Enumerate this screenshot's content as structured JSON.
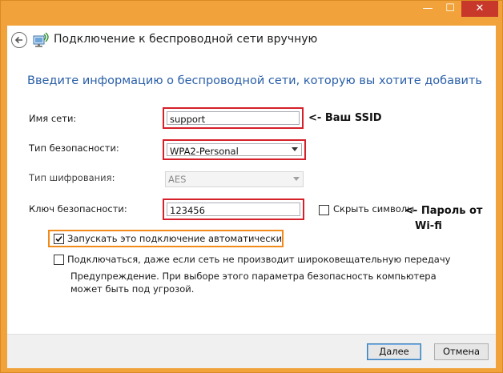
{
  "window": {
    "minimize_glyph": "—",
    "maximize_glyph": "☐",
    "close_glyph": "✕",
    "title": "Подключение к беспроводной сети вручную"
  },
  "main": {
    "instruction": "Введите информацию о беспроводной сети, которую вы хотите добавить",
    "network_name": {
      "label": "Имя сети:",
      "value": "support",
      "annotation": "<- Ваш SSID"
    },
    "security_type": {
      "label": "Тип безопасности:",
      "value": "WPA2-Personal"
    },
    "encryption_type": {
      "label": "Тип шифрования:",
      "value": "AES"
    },
    "security_key": {
      "label": "Ключ безопасности:",
      "value": "123456",
      "hide_chars_label": "Скрыть символы",
      "hide_chars_checked": false,
      "annotation_line1": "<- Пароль от",
      "annotation_line2": "Wi-fi"
    },
    "auto_connect": {
      "label": "Запускать это подключение автоматически",
      "checked": true
    },
    "connect_hidden": {
      "label": "Подключаться, даже если сеть не производит широковещательную передачу",
      "checked": false
    },
    "warning": "Предупреждение. При выборе этого параметра безопасность компьютера может быть под угрозой."
  },
  "footer": {
    "next_label": "Далее",
    "cancel_label": "Отмена"
  },
  "colors": {
    "frame": "#f2a23a",
    "close": "#c7372a",
    "heading": "#2a5fa8",
    "highlight_red": "#d6202a",
    "highlight_orange": "#f08a1a"
  },
  "icons": [
    "back-arrow-icon",
    "wireless-network-icon",
    "checkmark-icon",
    "dropdown-arrow-icon"
  ]
}
